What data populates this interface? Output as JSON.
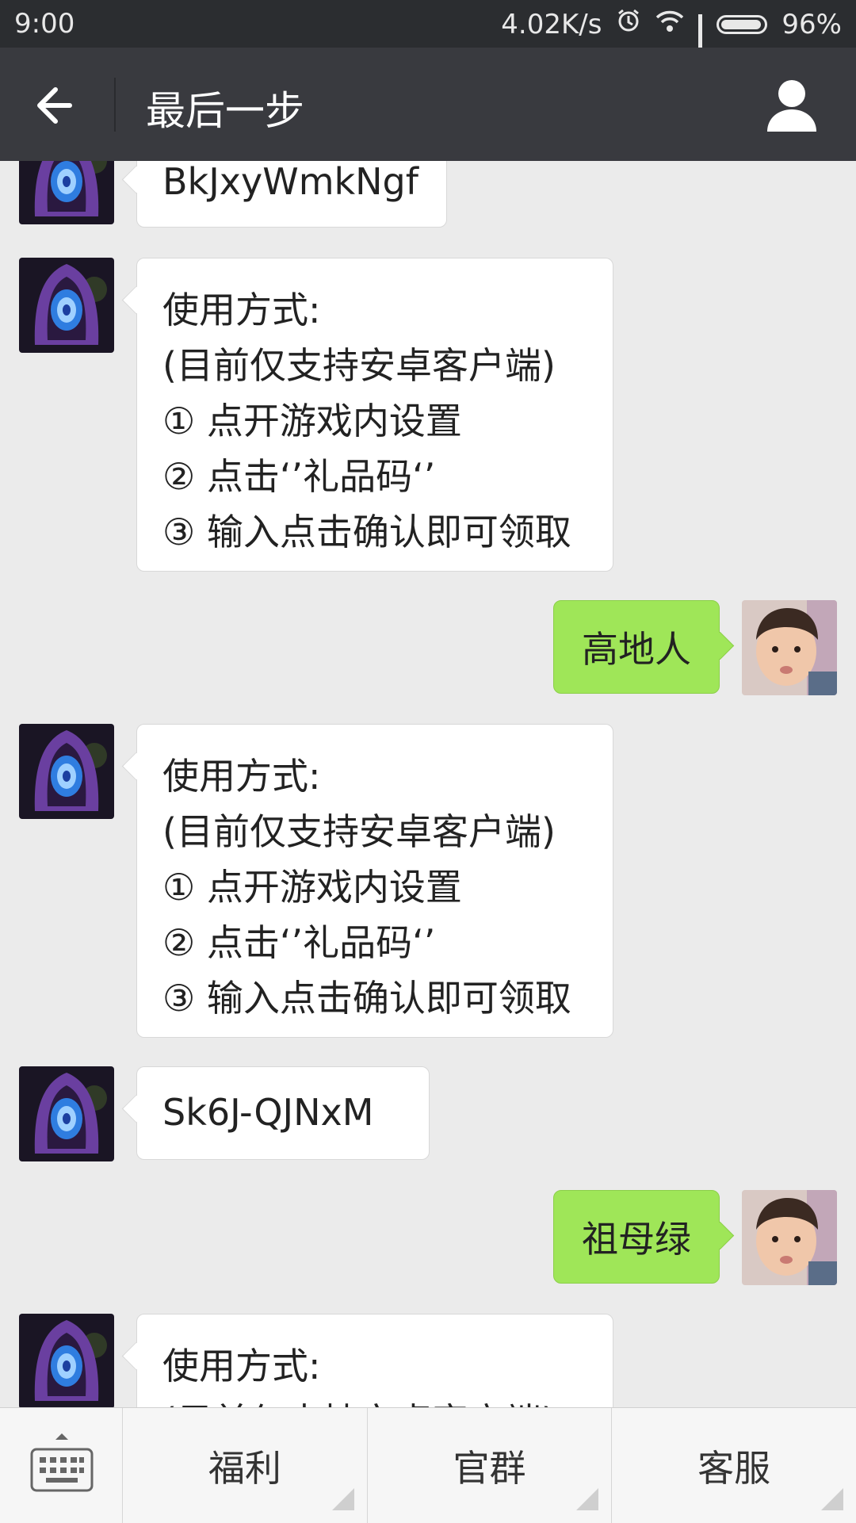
{
  "status_bar": {
    "time": "9:00",
    "speed": "4.02K/s",
    "battery": "96%"
  },
  "header": {
    "title": "最后一步"
  },
  "messages": [
    {
      "side": "left",
      "text": "BkJxyWmkNgf"
    },
    {
      "side": "left",
      "text": "使用方式:\n(目前仅支持安卓客户端)\n① 点开游戏内设置\n② 点击‘’礼品码‘’\n③ 输入点击确认即可领取"
    },
    {
      "side": "right",
      "text": "高地人"
    },
    {
      "side": "left",
      "text": "使用方式:\n(目前仅支持安卓客户端)\n① 点开游戏内设置\n② 点击‘’礼品码‘’\n③ 输入点击确认即可领取"
    },
    {
      "side": "left",
      "text": "Sk6J-QJNxM"
    },
    {
      "side": "right",
      "text": "祖母绿"
    },
    {
      "side": "left",
      "text": "使用方式:\n(目前仅支持安卓客户端)"
    }
  ],
  "bottom_menu": {
    "items": [
      "福利",
      "官群",
      "客服"
    ]
  },
  "colors": {
    "self_bubble": "#9fe658",
    "title_bar": "#393a3f",
    "chat_bg": "#ebebeb"
  },
  "icons": [
    "back-arrow-icon",
    "profile-icon",
    "keyboard-icon",
    "alarm-icon",
    "wifi-icon",
    "signal-icon",
    "battery-icon"
  ]
}
